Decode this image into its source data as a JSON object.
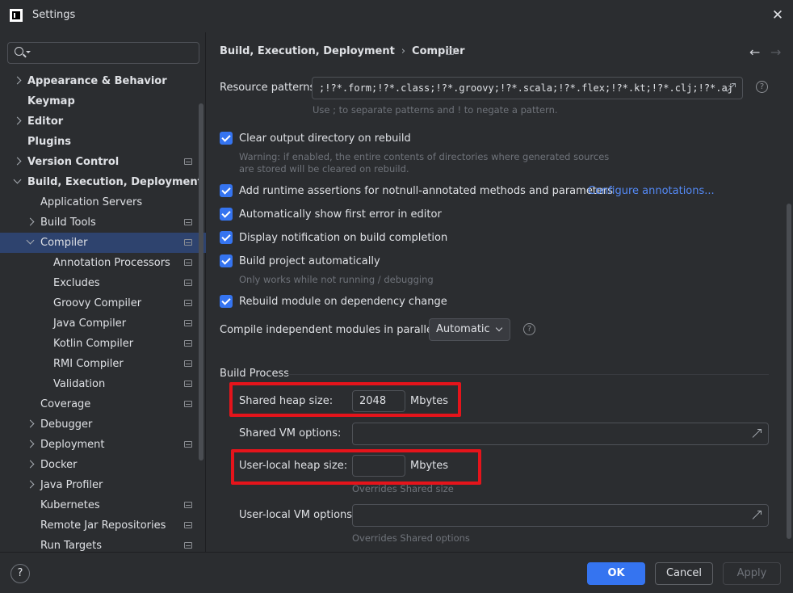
{
  "window": {
    "title": "Settings"
  },
  "search": {
    "placeholder": ""
  },
  "tree": [
    {
      "label": "Appearance & Behavior",
      "bold": true,
      "indent": 0,
      "chevron": "right",
      "icon": false
    },
    {
      "label": "Keymap",
      "bold": true,
      "indent": 0,
      "chevron": "none",
      "icon": false
    },
    {
      "label": "Editor",
      "bold": true,
      "indent": 0,
      "chevron": "right",
      "icon": false
    },
    {
      "label": "Plugins",
      "bold": true,
      "indent": 0,
      "chevron": "none",
      "icon": false
    },
    {
      "label": "Version Control",
      "bold": true,
      "indent": 0,
      "chevron": "right",
      "icon": true
    },
    {
      "label": "Build, Execution, Deployment",
      "bold": true,
      "indent": 0,
      "chevron": "down",
      "icon": false
    },
    {
      "label": "Application Servers",
      "bold": false,
      "indent": 1,
      "chevron": "none",
      "icon": false
    },
    {
      "label": "Build Tools",
      "bold": false,
      "indent": 1,
      "chevron": "right",
      "icon": true
    },
    {
      "label": "Compiler",
      "bold": false,
      "indent": 1,
      "chevron": "down",
      "icon": true,
      "selected": true
    },
    {
      "label": "Annotation Processors",
      "bold": false,
      "indent": 2,
      "chevron": "none",
      "icon": true
    },
    {
      "label": "Excludes",
      "bold": false,
      "indent": 2,
      "chevron": "none",
      "icon": true
    },
    {
      "label": "Groovy Compiler",
      "bold": false,
      "indent": 2,
      "chevron": "none",
      "icon": true
    },
    {
      "label": "Java Compiler",
      "bold": false,
      "indent": 2,
      "chevron": "none",
      "icon": true
    },
    {
      "label": "Kotlin Compiler",
      "bold": false,
      "indent": 2,
      "chevron": "none",
      "icon": true
    },
    {
      "label": "RMI Compiler",
      "bold": false,
      "indent": 2,
      "chevron": "none",
      "icon": true
    },
    {
      "label": "Validation",
      "bold": false,
      "indent": 2,
      "chevron": "none",
      "icon": true
    },
    {
      "label": "Coverage",
      "bold": false,
      "indent": 1,
      "chevron": "none",
      "icon": true
    },
    {
      "label": "Debugger",
      "bold": false,
      "indent": 1,
      "chevron": "right",
      "icon": false
    },
    {
      "label": "Deployment",
      "bold": false,
      "indent": 1,
      "chevron": "right",
      "icon": true
    },
    {
      "label": "Docker",
      "bold": false,
      "indent": 1,
      "chevron": "right",
      "icon": false
    },
    {
      "label": "Java Profiler",
      "bold": false,
      "indent": 1,
      "chevron": "right",
      "icon": false
    },
    {
      "label": "Kubernetes",
      "bold": false,
      "indent": 1,
      "chevron": "none",
      "icon": true
    },
    {
      "label": "Remote Jar Repositories",
      "bold": false,
      "indent": 1,
      "chevron": "none",
      "icon": true
    },
    {
      "label": "Run Targets",
      "bold": false,
      "indent": 1,
      "chevron": "none",
      "icon": true
    }
  ],
  "breadcrumb": {
    "parent": "Build, Execution, Deployment",
    "separator": "›",
    "current": "Compiler"
  },
  "resource": {
    "label": "Resource patterns:",
    "value": ";!?*.form;!?*.class;!?*.groovy;!?*.scala;!?*.flex;!?*.kt;!?*.clj;!?*.aj",
    "hint": "Use ; to separate patterns and ! to negate a pattern."
  },
  "options": {
    "clear_output": {
      "label": "Clear output directory on rebuild",
      "checked": true
    },
    "clear_warning_1": "Warning: if enabled, the entire contents of directories where generated sources",
    "clear_warning_2": "are stored will be cleared on rebuild.",
    "runtime_assertions": {
      "label": "Add runtime assertions for notnull-annotated methods and parameters",
      "checked": true
    },
    "configure_link": "Configure annotations...",
    "show_first_error": {
      "label": "Automatically show first error in editor",
      "checked": true
    },
    "notify_completion": {
      "label": "Display notification on build completion",
      "checked": true
    },
    "build_auto": {
      "label": "Build project automatically",
      "checked": true
    },
    "build_auto_hint": "Only works while not running / debugging",
    "rebuild_module": {
      "label": "Rebuild module on dependency change",
      "checked": true
    },
    "parallel_label": "Compile independent modules in parallel:",
    "parallel_value": "Automatic"
  },
  "build_process": {
    "title": "Build Process",
    "shared_heap_label": "Shared heap size:",
    "shared_heap_value": "2048",
    "shared_heap_unit": "Mbytes",
    "shared_vm_label": "Shared VM options:",
    "shared_vm_value": "",
    "local_heap_label": "User-local heap size:",
    "local_heap_value": "",
    "local_heap_unit": "Mbytes",
    "local_heap_hint": "Overrides Shared size",
    "local_vm_label": "User-local VM options:",
    "local_vm_value": "",
    "local_vm_hint": "Overrides Shared options"
  },
  "footer": {
    "help": "?",
    "ok": "OK",
    "cancel": "Cancel",
    "apply": "Apply"
  },
  "colors": {
    "accent": "#3574f0",
    "highlight": "#e5141b",
    "selection": "#2e436e",
    "link": "#548af7"
  }
}
